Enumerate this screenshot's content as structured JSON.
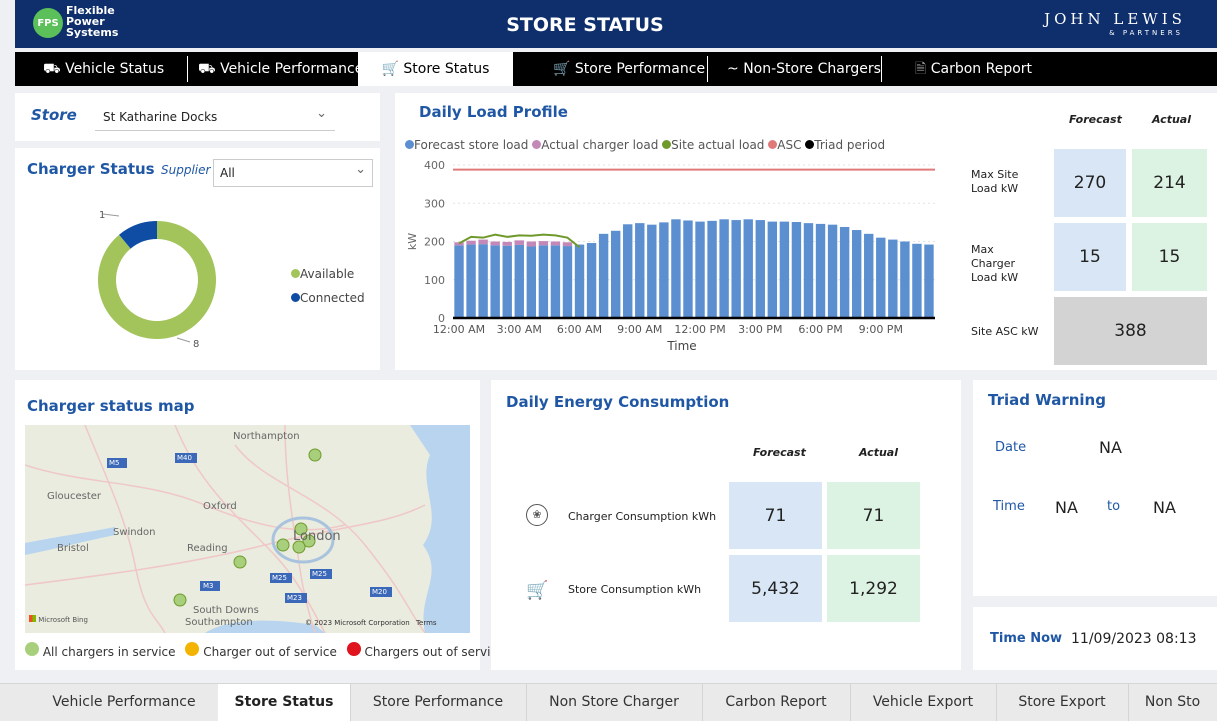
{
  "header": {
    "logo_badge": "FPS",
    "logo_line1": "Flexible",
    "logo_line2": "Power",
    "logo_line3": "Systems",
    "title": "STORE STATUS",
    "brand_main": "JOHN LEWIS",
    "brand_sub": "& PARTNERS"
  },
  "nav": {
    "items": [
      {
        "label": "Vehicle Status",
        "icon": "truck-icon"
      },
      {
        "label": "Vehicle Performance",
        "icon": "truck-icon"
      },
      {
        "label": "Store Status",
        "icon": "cart-icon"
      },
      {
        "label": "Store Performance",
        "icon": "cart-icon"
      },
      {
        "label": "Non-Store Chargers",
        "icon": "wave-icon"
      },
      {
        "label": "Carbon Report",
        "icon": "document-icon"
      }
    ]
  },
  "store": {
    "label": "Store",
    "selected": "St Katharine Docks"
  },
  "charger_status": {
    "title": "Charger Status",
    "supplier_label": "Supplier",
    "supplier_selected": "All",
    "legend": [
      {
        "label": "Available",
        "color": "#a3c45a"
      },
      {
        "label": "Connected",
        "color": "#0f4ca3"
      }
    ],
    "callout_connected": "1",
    "callout_available": "8"
  },
  "load_profile": {
    "title": "Daily Load Profile",
    "legend": [
      {
        "label": "Forecast store load",
        "color": "#5b8fd0"
      },
      {
        "label": "Actual charger load",
        "color": "#c488b8"
      },
      {
        "label": "Site actual load",
        "color": "#6f9a2b"
      },
      {
        "label": "ASC",
        "color": "#e07a7a"
      },
      {
        "label": "Triad period",
        "color": "#000000"
      }
    ]
  },
  "chart_data": {
    "type": "bar",
    "title": "Daily Load Profile",
    "xlabel": "Time",
    "ylabel": "kW",
    "ylim": [
      0,
      400
    ],
    "yticks": [
      0,
      100,
      200,
      300,
      400
    ],
    "xtick_labels": [
      "12:00 AM",
      "3:00 AM",
      "6:00 AM",
      "9:00 AM",
      "12:00 PM",
      "3:00 PM",
      "6:00 PM",
      "9:00 PM"
    ],
    "series": [
      {
        "name": "Forecast store load",
        "type": "bar",
        "values": [
          190,
          192,
          193,
          190,
          189,
          191,
          187,
          190,
          190,
          188,
          192,
          196,
          220,
          228,
          245,
          248,
          244,
          250,
          258,
          255,
          252,
          254,
          258,
          256,
          258,
          256,
          252,
          252,
          251,
          248,
          246,
          244,
          238,
          230,
          220,
          210,
          205,
          200,
          194,
          192
        ]
      },
      {
        "name": "Actual charger load",
        "type": "bar",
        "values": [
          8,
          10,
          12,
          10,
          10,
          12,
          13,
          11,
          10,
          10,
          0,
          0,
          0,
          0,
          0,
          0,
          0,
          0,
          0,
          0,
          0,
          0,
          0,
          0,
          0,
          0,
          0,
          0,
          0,
          0,
          0,
          0,
          0,
          0,
          0,
          0,
          0,
          0,
          0,
          0
        ]
      },
      {
        "name": "Site actual load",
        "type": "line",
        "values": [
          195,
          212,
          210,
          218,
          212,
          216,
          215,
          218,
          216,
          210,
          185
        ]
      },
      {
        "name": "ASC",
        "type": "line",
        "value": 388
      },
      {
        "name": "Triad period",
        "type": "line",
        "value": 0
      }
    ]
  },
  "load_kpis": {
    "forecast_label": "Forecast",
    "actual_label": "Actual",
    "max_site_label": "Max Site Load kW",
    "max_site_forecast": "270",
    "max_site_actual": "214",
    "max_charger_label": "Max Charger Load kW",
    "max_charger_forecast": "15",
    "max_charger_actual": "15",
    "asc_label": "Site ASC kW",
    "asc_value": "388"
  },
  "map": {
    "title": "Charger status map",
    "places": [
      "Northampton",
      "Gloucester",
      "Oxford",
      "Swindon",
      "Bristol",
      "Reading",
      "London",
      "South Downs",
      "Southampton"
    ],
    "roads": [
      "M5",
      "M40",
      "M3",
      "M25",
      "M25",
      "M23",
      "M20"
    ],
    "credit": "© 2023 Microsoft Corporation",
    "terms": "Terms",
    "bing": "Microsoft Bing",
    "legend": [
      {
        "label": "All chargers in service",
        "color": "#a8cf7c"
      },
      {
        "label": "Charger out of service",
        "color": "#f2b400"
      },
      {
        "label": "Chargers out of service",
        "color": "#e0131f"
      }
    ]
  },
  "energy": {
    "title": "Daily Energy Consumption",
    "forecast_label": "Forecast",
    "actual_label": "Actual",
    "charger_label": "Charger Consumption kWh",
    "charger_forecast": "71",
    "charger_actual": "71",
    "store_label": "Store Consumption kWh",
    "store_forecast": "5,432",
    "store_actual": "1,292"
  },
  "triad": {
    "title": "Triad Warning",
    "date_label": "Date",
    "date_value": "NA",
    "time_label": "Time",
    "time_from": "NA",
    "to_label": "to",
    "time_to": "NA"
  },
  "time_now": {
    "label": "Time Now",
    "value": "11/09/2023 08:13"
  },
  "bottom_tabs": [
    "Vehicle Performance",
    "Store Status",
    "Store Performance",
    "Non Store Charger",
    "Carbon Report",
    "Vehicle Export",
    "Store Export",
    "Non Sto"
  ]
}
